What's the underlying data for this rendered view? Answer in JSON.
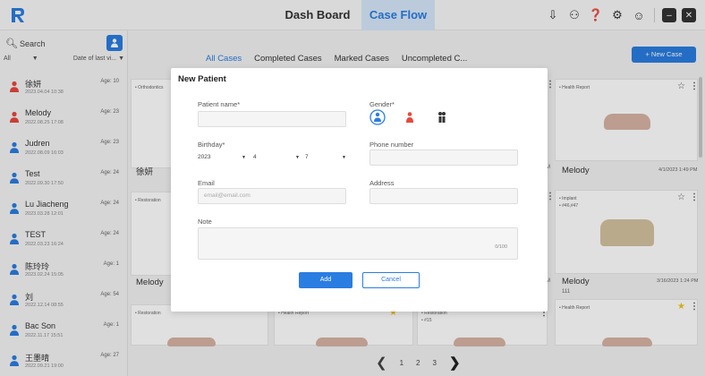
{
  "header": {
    "tabs": [
      {
        "label": "Dash Board",
        "active": false
      },
      {
        "label": "Case Flow",
        "active": true
      }
    ]
  },
  "sidebar": {
    "search_placeholder": "Search",
    "filter_all": "All",
    "filter_sort": "Date of last vi...",
    "patients": [
      {
        "name": "徐妍",
        "date": "2023.04.04 10:38",
        "age": "Age: 10",
        "gender": "female"
      },
      {
        "name": "Melody",
        "date": "2022.08.25 17:08",
        "age": "Age: 23",
        "gender": "female"
      },
      {
        "name": "Judren",
        "date": "2022.08.09 16:03",
        "age": "Age: 23",
        "gender": "male"
      },
      {
        "name": "Test",
        "date": "2022.09.30 17:50",
        "age": "Age: 24",
        "gender": "male"
      },
      {
        "name": "Lu Jiacheng",
        "date": "2023.03.28 12:01",
        "age": "Age: 24",
        "gender": "male"
      },
      {
        "name": "TEST",
        "date": "2022.03.23 16:24",
        "age": "Age: 24",
        "gender": "male"
      },
      {
        "name": "陈玲玲",
        "date": "2023.02.24 15:05",
        "age": "Age: 1",
        "gender": "male"
      },
      {
        "name": "刘",
        "date": "2022.12.14 08:55",
        "age": "Age: 54",
        "gender": "male"
      },
      {
        "name": "Bac Son",
        "date": "2022.11.17 15:51",
        "age": "Age: 1",
        "gender": "male"
      },
      {
        "name": "王墨晴",
        "date": "2022.09.21 19:00",
        "age": "Age: 27",
        "gender": "male"
      }
    ]
  },
  "main": {
    "filter_tabs": [
      "All Cases",
      "Completed Cases",
      "Marked Cases",
      "Uncompleted C..."
    ],
    "new_case_label": "+ New Case",
    "cards": {
      "c1_tag": "• Orthodontics",
      "c1_name": "徐妍",
      "c2_tag": "• Restoration",
      "c3_name": "Melody",
      "c4_tag": "• Restoration",
      "c5_tag": "• Health Report",
      "c6_tag": "• Restoration",
      "c6_tag2": "• #15",
      "r1_tag": "• Health Report",
      "r1_name": "Melody",
      "r1_date": "4/1/2023 1:49 PM",
      "r2_tag": "• Implant",
      "r2_tag2": "• #46,#47",
      "r2_name": "Melody",
      "r2_sub": "111",
      "r2_date": "3/16/2023 1:24 PM",
      "r3_tag": "• Health Report",
      "mid1_suffix": "M",
      "mid2_suffix": "M"
    },
    "pager": {
      "pages": [
        "1",
        "2",
        "3"
      ]
    }
  },
  "modal": {
    "title": "New Patient",
    "patient_name_label": "Patient name*",
    "gender_label": "Gender*",
    "birthday_label": "Birthday*",
    "birthday_year": "2023",
    "birthday_month": "4",
    "birthday_day": "7",
    "phone_label": "Phone number",
    "email_label": "Email",
    "email_placeholder": "email@email.com",
    "address_label": "Address",
    "note_label": "Note",
    "note_counter": "0/100",
    "add_label": "Add",
    "cancel_label": "Cancel"
  },
  "colors": {
    "accent": "#2a7de1",
    "female": "#e8473d",
    "male": "#2a7de1",
    "star": "#f0c419"
  }
}
